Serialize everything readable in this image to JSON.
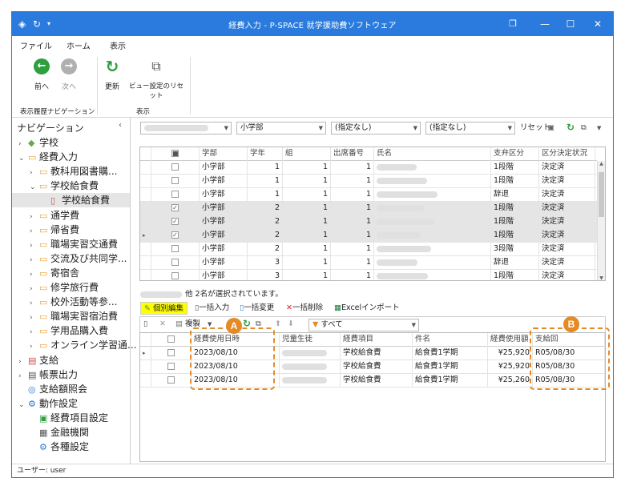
{
  "window": {
    "title": "経費入力 - P-SPACE 就学援助費ソフトウェア",
    "min_label": "—",
    "max_label": "☐",
    "close_label": "✕",
    "restore_label": "❐"
  },
  "menu": {
    "file": "ファイル",
    "home": "ホーム",
    "view": "表示"
  },
  "ribbon": {
    "back": "前へ",
    "next": "次へ",
    "refresh": "更新",
    "reset_view": "ビュー設定のリセット",
    "group_history": "表示履歴ナビゲーション",
    "group_view": "表示"
  },
  "nav": {
    "header": "ナビゲーション",
    "items": [
      {
        "label": "学校",
        "level": 0,
        "arrow": ">"
      },
      {
        "label": "経費入力",
        "level": 0,
        "arrow": "v"
      },
      {
        "label": "教科用図書購...",
        "level": 1,
        "arrow": ">"
      },
      {
        "label": "学校給食費",
        "level": 1,
        "arrow": "v"
      },
      {
        "label": "学校給食費",
        "level": 2,
        "arrow": ""
      },
      {
        "label": "通学費",
        "level": 1,
        "arrow": ">"
      },
      {
        "label": "帰省費",
        "level": 1,
        "arrow": ">"
      },
      {
        "label": "職場実習交通費",
        "level": 1,
        "arrow": ">"
      },
      {
        "label": "交流及び共同学...",
        "level": 1,
        "arrow": ">"
      },
      {
        "label": "寄宿舎",
        "level": 1,
        "arrow": ">"
      },
      {
        "label": "修学旅行費",
        "level": 1,
        "arrow": ">"
      },
      {
        "label": "校外活動等参...",
        "level": 1,
        "arrow": ">"
      },
      {
        "label": "職場実習宿泊費",
        "level": 1,
        "arrow": ">"
      },
      {
        "label": "学用品購入費",
        "level": 1,
        "arrow": ">"
      },
      {
        "label": "オンライン学習通...",
        "level": 1,
        "arrow": ">"
      },
      {
        "label": "支給",
        "level": 0,
        "arrow": ">"
      },
      {
        "label": "帳票出力",
        "level": 0,
        "arrow": ">"
      },
      {
        "label": "支給額照会",
        "level": 0,
        "arrow": ""
      },
      {
        "label": "動作設定",
        "level": 0,
        "arrow": "v"
      },
      {
        "label": "経費項目設定",
        "level": 1,
        "arrow": ""
      },
      {
        "label": "金融機関",
        "level": 1,
        "arrow": ""
      },
      {
        "label": "各種設定",
        "level": 1,
        "arrow": ""
      }
    ]
  },
  "filters": {
    "school_type": "小学部",
    "filter2": "(指定なし)",
    "filter3": "(指定なし)",
    "reset": "リセット"
  },
  "student_grid": {
    "headers": [
      "学部",
      "学年",
      "組",
      "出席番号",
      "氏名",
      "支弁区分",
      "区分決定状況"
    ],
    "rows": [
      {
        "checked": false,
        "dept": "小学部",
        "grade": "1",
        "class": "1",
        "no": "1",
        "level": "1段階",
        "status": "決定済"
      },
      {
        "checked": false,
        "dept": "小学部",
        "grade": "1",
        "class": "1",
        "no": "1",
        "level": "1段階",
        "status": "決定済"
      },
      {
        "checked": false,
        "dept": "小学部",
        "grade": "1",
        "class": "1",
        "no": "1",
        "level": "辞退",
        "status": "決定済"
      },
      {
        "checked": true,
        "dept": "小学部",
        "grade": "2",
        "class": "1",
        "no": "1",
        "level": "1段階",
        "status": "決定済"
      },
      {
        "checked": true,
        "dept": "小学部",
        "grade": "2",
        "class": "1",
        "no": "1",
        "level": "1段階",
        "status": "決定済"
      },
      {
        "checked": true,
        "dept": "小学部",
        "grade": "2",
        "class": "1",
        "no": "1",
        "level": "1段階",
        "status": "決定済"
      },
      {
        "checked": false,
        "dept": "小学部",
        "grade": "2",
        "class": "1",
        "no": "1",
        "level": "3段階",
        "status": "決定済"
      },
      {
        "checked": false,
        "dept": "小学部",
        "grade": "3",
        "class": "1",
        "no": "1",
        "level": "辞退",
        "status": "決定済"
      },
      {
        "checked": false,
        "dept": "小学部",
        "grade": "3",
        "class": "1",
        "no": "1",
        "level": "1段階",
        "status": "決定済"
      }
    ]
  },
  "selection_info": "他 2名が選択されています。",
  "edit_tabs": {
    "individual": "個別編集",
    "bulk_input": "一括入力",
    "bulk_change": "一括変更",
    "bulk_delete": "一括削除",
    "excel_import": "Excelインポート"
  },
  "edit_toolbar": {
    "copy": "複製",
    "filter_all": "すべて"
  },
  "expense_grid": {
    "headers": [
      "経費使用日時",
      "児童生徒",
      "経費項目",
      "件名",
      "経費使用額",
      "支給回"
    ],
    "rows": [
      {
        "date": "2023/08/10",
        "item": "学校給食費",
        "subject": "給食費1学期",
        "amount": "¥25,920",
        "round": "R05/08/30"
      },
      {
        "date": "2023/08/10",
        "item": "学校給食費",
        "subject": "給食費1学期",
        "amount": "¥25,920",
        "round": "R05/08/30"
      },
      {
        "date": "2023/08/10",
        "item": "学校給食費",
        "subject": "給食費1学期",
        "amount": "¥25,260",
        "round": "R05/08/30"
      }
    ]
  },
  "annotations": {
    "a": "A",
    "b": "B"
  },
  "statusbar": {
    "user": "ユーザー: user"
  },
  "colors": {
    "titlebar": "#2a7bdd",
    "accent_orange": "#e58a24",
    "tab_highlight": "#ffff00",
    "green": "#2e9e3e"
  }
}
